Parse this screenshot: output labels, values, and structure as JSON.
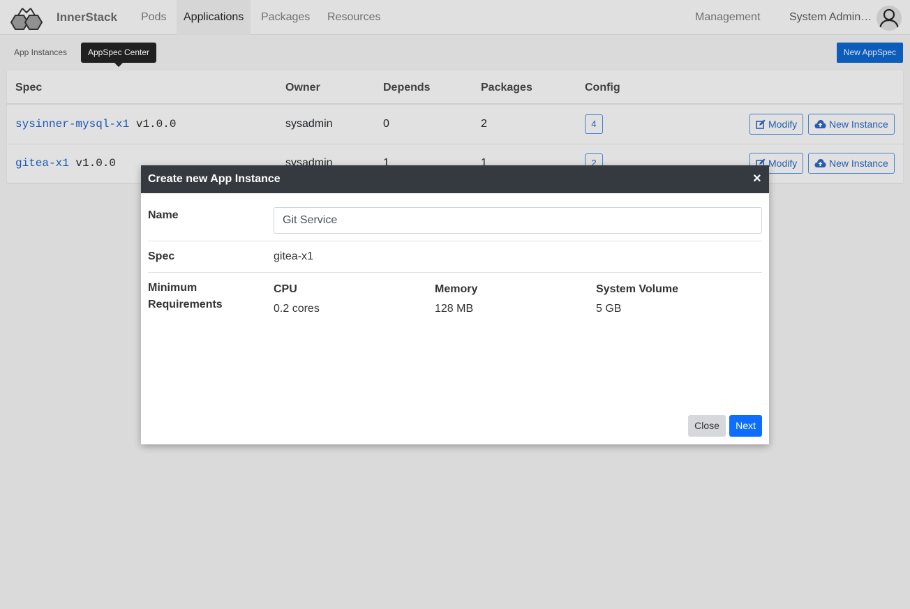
{
  "nav": {
    "brand": "InnerStack",
    "items": [
      "Pods",
      "Applications",
      "Packages",
      "Resources"
    ],
    "active": "Applications",
    "management": "Management",
    "user": "System Admin…"
  },
  "toolbar": {
    "tabs": [
      "App Instances",
      "AppSpec Center"
    ],
    "active_tab": "AppSpec Center",
    "new_spec": "New AppSpec"
  },
  "table": {
    "headers": [
      "Spec",
      "Owner",
      "Depends",
      "Packages",
      "Config"
    ],
    "rows": [
      {
        "spec": "sysinner-mysql-x1",
        "version": "v1.0.0",
        "owner": "sysadmin",
        "depends": "0",
        "packages": "2",
        "config": "4"
      },
      {
        "spec": "gitea-x1",
        "version": "v1.0.0",
        "owner": "sysadmin",
        "depends": "1",
        "packages": "1",
        "config": "2"
      }
    ],
    "actions": {
      "modify": "Modify",
      "new_instance": "New Instance"
    }
  },
  "modal": {
    "title": "Create new App Instance",
    "close_glyph": "×",
    "name_label": "Name",
    "name_value": "Git Service",
    "spec_label": "Spec",
    "spec_value": "gitea-x1",
    "req_label_1": "Minimum",
    "req_label_2": "Requirements",
    "req": {
      "cpu_label": "CPU",
      "cpu_value": "0.2 cores",
      "memory_label": "Memory",
      "memory_value": "128 MB",
      "volume_label": "System Volume",
      "volume_value": "5 GB"
    },
    "close_btn": "Close",
    "next_btn": "Next"
  },
  "colors": {
    "accent": "#0d6efd",
    "header_dark": "#343a40",
    "link": "#1a5ec0"
  }
}
